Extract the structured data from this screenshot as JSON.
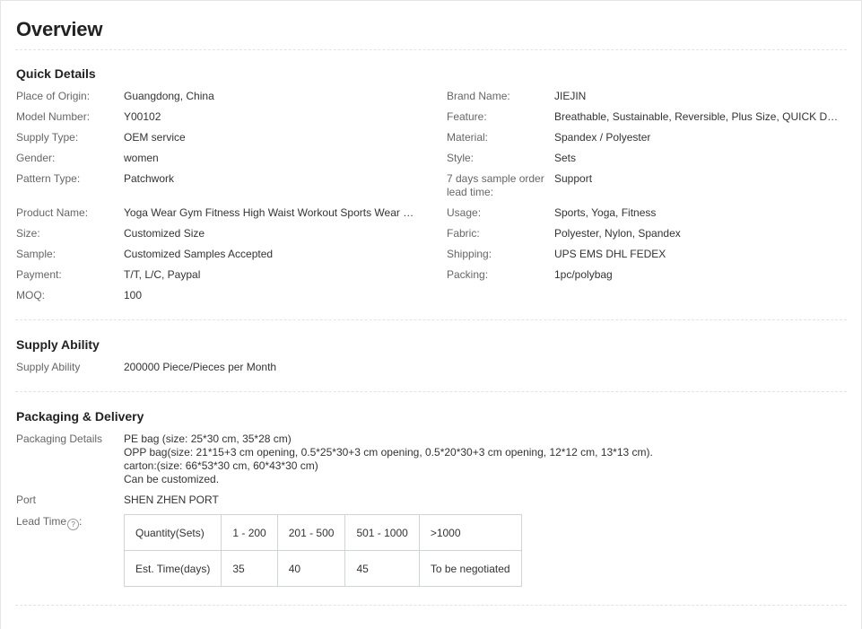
{
  "overview": {
    "title": "Overview"
  },
  "quick_details": {
    "title": "Quick Details",
    "left": [
      {
        "label": "Place of Origin:",
        "value": "Guangdong, China"
      },
      {
        "label": "Model Number:",
        "value": "Y00102"
      },
      {
        "label": "Supply Type:",
        "value": "OEM service"
      },
      {
        "label": "Gender:",
        "value": "women"
      },
      {
        "label": "Pattern Type:",
        "value": "Patchwork"
      },
      {
        "label": "Product Name:",
        "value": "Yoga Wear Gym Fitness High Waist Workout Sports Wear Se..."
      },
      {
        "label": "Size:",
        "value": "Customized Size"
      },
      {
        "label": "Sample:",
        "value": "Customized Samples Accepted"
      },
      {
        "label": "Payment:",
        "value": "T/T, L/C, Paypal"
      },
      {
        "label": "MOQ:",
        "value": "100"
      }
    ],
    "right": [
      {
        "label": "Brand Name:",
        "value": "JIEJIN"
      },
      {
        "label": "Feature:",
        "value": "Breathable, Sustainable, Reversible, Plus Size, QUICK DRY, Se..."
      },
      {
        "label": "Material:",
        "value": "Spandex / Polyester"
      },
      {
        "label": "Style:",
        "value": "Sets"
      },
      {
        "label": "7 days sample order lead time:",
        "value": "Support"
      },
      {
        "label": "Usage:",
        "value": "Sports, Yoga, Fitness"
      },
      {
        "label": "Fabric:",
        "value": "Polyester, Nylon, Spandex"
      },
      {
        "label": "Shipping:",
        "value": "UPS EMS DHL FEDEX"
      },
      {
        "label": "Packing:",
        "value": "1pc/polybag"
      }
    ]
  },
  "supply_ability": {
    "title": "Supply Ability",
    "label": "Supply Ability",
    "value": "200000 Piece/Pieces per Month"
  },
  "packaging_delivery": {
    "title": "Packaging & Delivery",
    "details_label": "Packaging Details",
    "details_lines": [
      "PE bag (size: 25*30 cm, 35*28 cm)",
      "OPP bag(size: 21*15+3 cm opening, 0.5*25*30+3 cm opening, 0.5*20*30+3 cm opening, 12*12 cm, 13*13 cm).",
      "carton:(size: 66*53*30 cm, 60*43*30 cm)",
      "Can be customized."
    ],
    "port_label": "Port",
    "port_value": "SHEN ZHEN PORT",
    "lead_time_label": "Lead Time",
    "lead_time_suffix": ":",
    "help_glyph": "?",
    "lead_time_table": {
      "header": [
        "Quantity(Sets)",
        "1 - 200",
        "201 - 500",
        "501 - 1000",
        ">1000"
      ],
      "row": [
        "Est. Time(days)",
        "35",
        "40",
        "45",
        "To be negotiated"
      ]
    }
  }
}
